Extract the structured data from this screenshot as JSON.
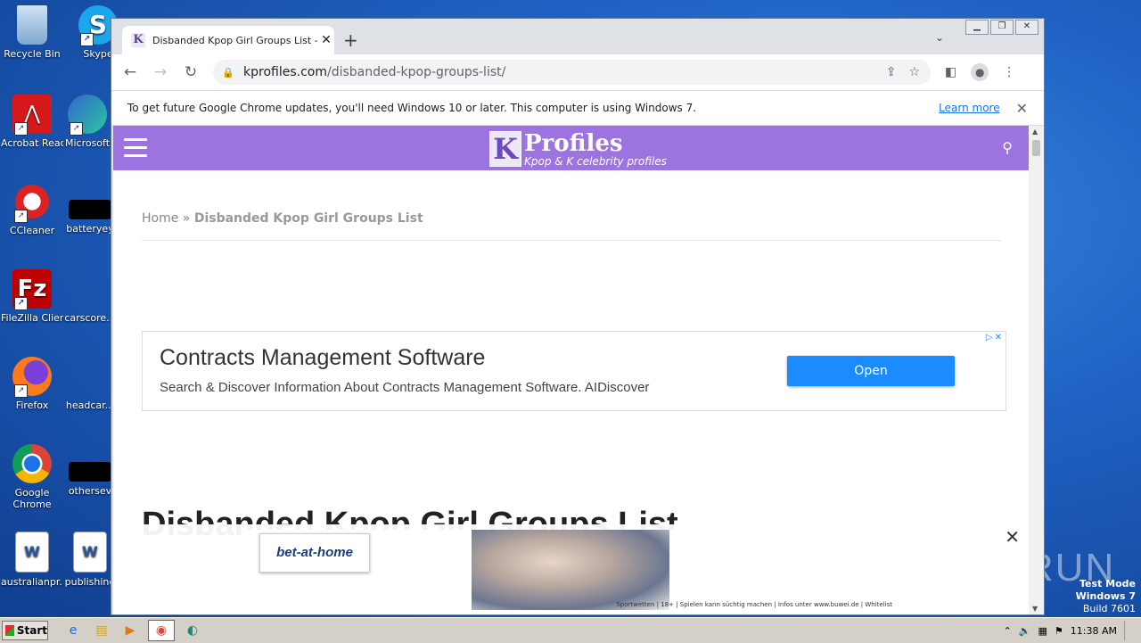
{
  "desktop": {
    "icons": [
      {
        "label": "Recycle Bin",
        "name": "recycle-bin-icon"
      },
      {
        "label": "Skype",
        "name": "skype-icon"
      },
      {
        "label": "Acrobat Reader DC",
        "name": "acrobat-icon"
      },
      {
        "label": "Microsoft",
        "name": "edge-icon"
      },
      {
        "label": "CCleaner",
        "name": "ccleaner-icon"
      },
      {
        "label": "batteryey",
        "name": "file-icon"
      },
      {
        "label": "FileZilla Client",
        "name": "filezilla-icon"
      },
      {
        "label": "carscore...",
        "name": "file-icon"
      },
      {
        "label": "Firefox",
        "name": "firefox-icon"
      },
      {
        "label": "headcar...",
        "name": "file-icon"
      },
      {
        "label": "Google Chrome",
        "name": "chrome-icon"
      },
      {
        "label": "othersev",
        "name": "file-icon"
      },
      {
        "label": "australianpr...",
        "name": "word-doc-icon"
      },
      {
        "label": "publishing",
        "name": "word-doc-icon"
      }
    ],
    "watermark": "ANY RUN",
    "testmode": {
      "line1": "Test Mode",
      "line2": "Windows 7",
      "line3": "Build 7601"
    }
  },
  "browser": {
    "tab": {
      "title": "Disbanded Kpop Girl Groups List - Kp",
      "favicon": "K"
    },
    "url": {
      "host": "kprofiles.com",
      "path": "/disbanded-kpop-groups-list/"
    },
    "infobar": {
      "message": "To get future Google Chrome updates, you'll need Windows 10 or later. This computer is using Windows 7.",
      "learn_more": "Learn more"
    }
  },
  "site": {
    "logo": {
      "letter": "K",
      "word": "Profiles",
      "tagline": "Kpop & K celebrity profiles"
    },
    "breadcrumb": {
      "home": "Home",
      "separator": "»",
      "current": "Disbanded Kpop Girl Groups List"
    },
    "ad": {
      "headline": "Contracts Management Software",
      "subline": "Search & Discover Information About Contracts Management Software. AIDiscover",
      "button": "Open"
    },
    "page_title": "Disbanded Kpop Girl Groups List",
    "sticky_ad": {
      "brand": "bet-at-home",
      "disclaimer": "Sportwetten | 18+ | Spielen kann süchtig machen | Infos unter www.buwei.de | Whitelist"
    }
  },
  "taskbar": {
    "start_label": "Start",
    "clock": "11:38 AM"
  },
  "colors": {
    "site_header": "#9c73e0",
    "ad_button": "#1a8cff"
  }
}
